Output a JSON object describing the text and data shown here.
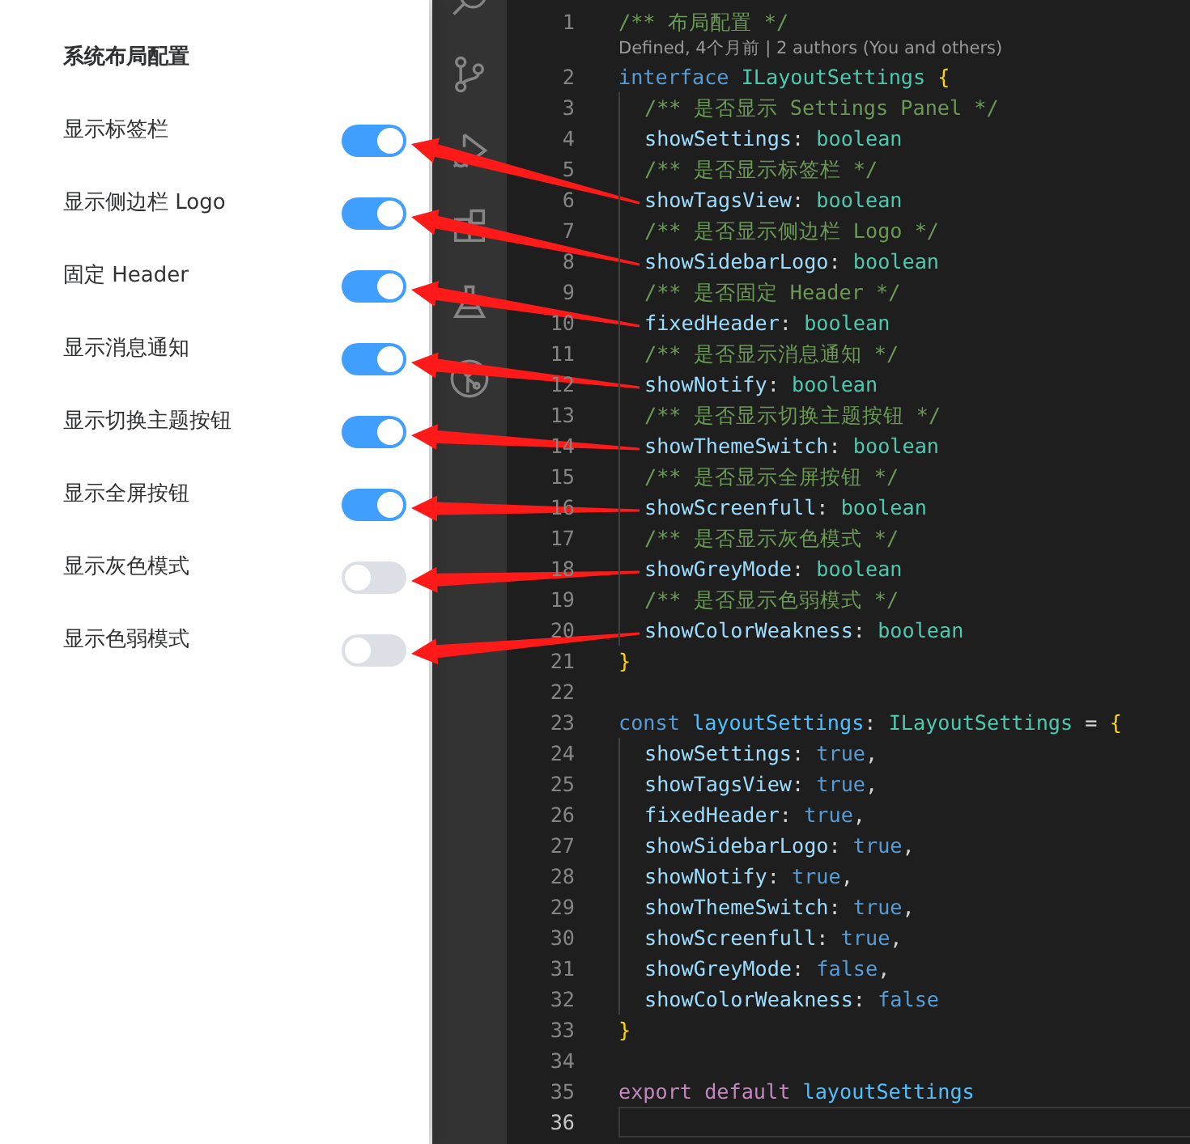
{
  "settings_panel": {
    "title": "系统布局配置",
    "settings": [
      {
        "label": "显示标签栏",
        "on": true
      },
      {
        "label": "显示侧边栏 Logo",
        "on": true
      },
      {
        "label": "固定 Header",
        "on": true
      },
      {
        "label": "显示消息通知",
        "on": true
      },
      {
        "label": "显示切换主题按钮",
        "on": true
      },
      {
        "label": "显示全屏按钮",
        "on": true
      },
      {
        "label": "显示灰色模式",
        "on": false
      },
      {
        "label": "显示色弱模式",
        "on": false
      }
    ]
  },
  "activity_bar": {
    "icons": [
      {
        "kind": "search"
      },
      {
        "kind": "source-control"
      },
      {
        "kind": "run-debug"
      },
      {
        "kind": "extensions"
      },
      {
        "kind": "flask"
      },
      {
        "kind": "git-graph"
      }
    ]
  },
  "editor": {
    "lines": [
      {
        "kind": "code",
        "number": "1",
        "indented": false,
        "arrow": false,
        "current": false,
        "tokens": [
          {
            "kind": "comment",
            "text": "/** 布局配置 */"
          }
        ]
      },
      {
        "kind": "codelens",
        "text": "Defined, 4个月前 | 2 authors (You and others)"
      },
      {
        "kind": "code",
        "number": "2",
        "indented": false,
        "arrow": false,
        "current": false,
        "tokens": [
          {
            "kind": "keyword",
            "text": "interface "
          },
          {
            "kind": "type",
            "text": "ILayoutSettings"
          },
          {
            "kind": "bracket",
            "text": " {"
          }
        ]
      },
      {
        "kind": "code",
        "number": "3",
        "indented": true,
        "arrow": false,
        "current": false,
        "tokens": [
          {
            "kind": "comment",
            "text": "/** 是否显示 Settings Panel */"
          }
        ]
      },
      {
        "kind": "code",
        "number": "4",
        "indented": true,
        "arrow": false,
        "current": false,
        "tokens": [
          {
            "kind": "property",
            "text": "showSettings"
          },
          {
            "kind": "punct",
            "text": ": "
          },
          {
            "kind": "type",
            "text": "boolean"
          }
        ]
      },
      {
        "kind": "code",
        "number": "5",
        "indented": true,
        "arrow": false,
        "current": false,
        "tokens": [
          {
            "kind": "comment",
            "text": "/** 是否显示标签栏 */"
          }
        ]
      },
      {
        "kind": "code",
        "number": "6",
        "indented": true,
        "arrow": true,
        "current": false,
        "tokens": [
          {
            "kind": "property",
            "text": "showTagsView"
          },
          {
            "kind": "punct",
            "text": ": "
          },
          {
            "kind": "type",
            "text": "boolean"
          }
        ]
      },
      {
        "kind": "code",
        "number": "7",
        "indented": true,
        "arrow": false,
        "current": false,
        "tokens": [
          {
            "kind": "comment",
            "text": "/** 是否显示侧边栏 Logo */"
          }
        ]
      },
      {
        "kind": "code",
        "number": "8",
        "indented": true,
        "arrow": true,
        "current": false,
        "tokens": [
          {
            "kind": "property",
            "text": "showSidebarLogo"
          },
          {
            "kind": "punct",
            "text": ": "
          },
          {
            "kind": "type",
            "text": "boolean"
          }
        ]
      },
      {
        "kind": "code",
        "number": "9",
        "indented": true,
        "arrow": false,
        "current": false,
        "tokens": [
          {
            "kind": "comment",
            "text": "/** 是否固定 Header */"
          }
        ]
      },
      {
        "kind": "code",
        "number": "10",
        "indented": true,
        "arrow": true,
        "current": false,
        "tokens": [
          {
            "kind": "property",
            "text": "fixedHeader"
          },
          {
            "kind": "punct",
            "text": ": "
          },
          {
            "kind": "type",
            "text": "boolean"
          }
        ]
      },
      {
        "kind": "code",
        "number": "11",
        "indented": true,
        "arrow": false,
        "current": false,
        "tokens": [
          {
            "kind": "comment",
            "text": "/** 是否显示消息通知 */"
          }
        ]
      },
      {
        "kind": "code",
        "number": "12",
        "indented": true,
        "arrow": true,
        "current": false,
        "tokens": [
          {
            "kind": "property",
            "text": "showNotify"
          },
          {
            "kind": "punct",
            "text": ": "
          },
          {
            "kind": "type",
            "text": "boolean"
          }
        ]
      },
      {
        "kind": "code",
        "number": "13",
        "indented": true,
        "arrow": false,
        "current": false,
        "tokens": [
          {
            "kind": "comment",
            "text": "/** 是否显示切换主题按钮 */"
          }
        ]
      },
      {
        "kind": "code",
        "number": "14",
        "indented": true,
        "arrow": true,
        "current": false,
        "tokens": [
          {
            "kind": "property",
            "text": "showThemeSwitch"
          },
          {
            "kind": "punct",
            "text": ": "
          },
          {
            "kind": "type",
            "text": "boolean"
          }
        ]
      },
      {
        "kind": "code",
        "number": "15",
        "indented": true,
        "arrow": false,
        "current": false,
        "tokens": [
          {
            "kind": "comment",
            "text": "/** 是否显示全屏按钮 */"
          }
        ]
      },
      {
        "kind": "code",
        "number": "16",
        "indented": true,
        "arrow": true,
        "current": false,
        "tokens": [
          {
            "kind": "property",
            "text": "showScreenfull"
          },
          {
            "kind": "punct",
            "text": ": "
          },
          {
            "kind": "type",
            "text": "boolean"
          }
        ]
      },
      {
        "kind": "code",
        "number": "17",
        "indented": true,
        "arrow": false,
        "current": false,
        "tokens": [
          {
            "kind": "comment",
            "text": "/** 是否显示灰色模式 */"
          }
        ]
      },
      {
        "kind": "code",
        "number": "18",
        "indented": true,
        "arrow": true,
        "current": false,
        "tokens": [
          {
            "kind": "property",
            "text": "showGreyMode"
          },
          {
            "kind": "punct",
            "text": ": "
          },
          {
            "kind": "type",
            "text": "boolean"
          }
        ]
      },
      {
        "kind": "code",
        "number": "19",
        "indented": true,
        "arrow": false,
        "current": false,
        "tokens": [
          {
            "kind": "comment",
            "text": "/** 是否显示色弱模式 */"
          }
        ]
      },
      {
        "kind": "code",
        "number": "20",
        "indented": true,
        "arrow": true,
        "current": false,
        "tokens": [
          {
            "kind": "property",
            "text": "showColorWeakness"
          },
          {
            "kind": "punct",
            "text": ": "
          },
          {
            "kind": "type",
            "text": "boolean"
          }
        ]
      },
      {
        "kind": "code",
        "number": "21",
        "indented": false,
        "arrow": false,
        "current": false,
        "tokens": [
          {
            "kind": "bracket",
            "text": "}"
          }
        ]
      },
      {
        "kind": "code",
        "number": "22",
        "indented": false,
        "arrow": false,
        "current": false
      },
      {
        "kind": "code",
        "number": "23",
        "indented": false,
        "arrow": false,
        "current": false,
        "tokens": [
          {
            "kind": "keyword",
            "text": "const "
          },
          {
            "kind": "variable",
            "text": "layoutSettings"
          },
          {
            "kind": "punct",
            "text": ": "
          },
          {
            "kind": "type",
            "text": "ILayoutSettings"
          },
          {
            "kind": "punct",
            "text": " = "
          },
          {
            "kind": "bracket",
            "text": "{"
          }
        ]
      },
      {
        "kind": "code",
        "number": "24",
        "indented": true,
        "arrow": false,
        "current": false,
        "tokens": [
          {
            "kind": "property",
            "text": "showSettings"
          },
          {
            "kind": "punct",
            "text": ": "
          },
          {
            "kind": "bool",
            "text": "true"
          },
          {
            "kind": "punct",
            "text": ","
          }
        ]
      },
      {
        "kind": "code",
        "number": "25",
        "indented": true,
        "arrow": false,
        "current": false,
        "tokens": [
          {
            "kind": "property",
            "text": "showTagsView"
          },
          {
            "kind": "punct",
            "text": ": "
          },
          {
            "kind": "bool",
            "text": "true"
          },
          {
            "kind": "punct",
            "text": ","
          }
        ]
      },
      {
        "kind": "code",
        "number": "26",
        "indented": true,
        "arrow": false,
        "current": false,
        "tokens": [
          {
            "kind": "property",
            "text": "fixedHeader"
          },
          {
            "kind": "punct",
            "text": ": "
          },
          {
            "kind": "bool",
            "text": "true"
          },
          {
            "kind": "punct",
            "text": ","
          }
        ]
      },
      {
        "kind": "code",
        "number": "27",
        "indented": true,
        "arrow": false,
        "current": false,
        "tokens": [
          {
            "kind": "property",
            "text": "showSidebarLogo"
          },
          {
            "kind": "punct",
            "text": ": "
          },
          {
            "kind": "bool",
            "text": "true"
          },
          {
            "kind": "punct",
            "text": ","
          }
        ]
      },
      {
        "kind": "code",
        "number": "28",
        "indented": true,
        "arrow": false,
        "current": false,
        "tokens": [
          {
            "kind": "property",
            "text": "showNotify"
          },
          {
            "kind": "punct",
            "text": ": "
          },
          {
            "kind": "bool",
            "text": "true"
          },
          {
            "kind": "punct",
            "text": ","
          }
        ]
      },
      {
        "kind": "code",
        "number": "29",
        "indented": true,
        "arrow": false,
        "current": false,
        "tokens": [
          {
            "kind": "property",
            "text": "showThemeSwitch"
          },
          {
            "kind": "punct",
            "text": ": "
          },
          {
            "kind": "bool",
            "text": "true"
          },
          {
            "kind": "punct",
            "text": ","
          }
        ]
      },
      {
        "kind": "code",
        "number": "30",
        "indented": true,
        "arrow": false,
        "current": false,
        "tokens": [
          {
            "kind": "property",
            "text": "showScreenfull"
          },
          {
            "kind": "punct",
            "text": ": "
          },
          {
            "kind": "bool",
            "text": "true"
          },
          {
            "kind": "punct",
            "text": ","
          }
        ]
      },
      {
        "kind": "code",
        "number": "31",
        "indented": true,
        "arrow": false,
        "current": false,
        "tokens": [
          {
            "kind": "property",
            "text": "showGreyMode"
          },
          {
            "kind": "punct",
            "text": ": "
          },
          {
            "kind": "bool",
            "text": "false"
          },
          {
            "kind": "punct",
            "text": ","
          }
        ]
      },
      {
        "kind": "code",
        "number": "32",
        "indented": true,
        "arrow": false,
        "current": false,
        "tokens": [
          {
            "kind": "property",
            "text": "showColorWeakness"
          },
          {
            "kind": "punct",
            "text": ": "
          },
          {
            "kind": "bool",
            "text": "false"
          }
        ]
      },
      {
        "kind": "code",
        "number": "33",
        "indented": false,
        "arrow": false,
        "current": false,
        "tokens": [
          {
            "kind": "bracket",
            "text": "}"
          }
        ]
      },
      {
        "kind": "code",
        "number": "34",
        "indented": false,
        "arrow": false,
        "current": false
      },
      {
        "kind": "code",
        "number": "35",
        "indented": false,
        "arrow": false,
        "current": false,
        "tokens": [
          {
            "kind": "control",
            "text": "export default "
          },
          {
            "kind": "variable",
            "text": "layoutSettings"
          }
        ]
      },
      {
        "kind": "code",
        "number": "36",
        "indented": false,
        "arrow": false,
        "current": true
      }
    ]
  }
}
